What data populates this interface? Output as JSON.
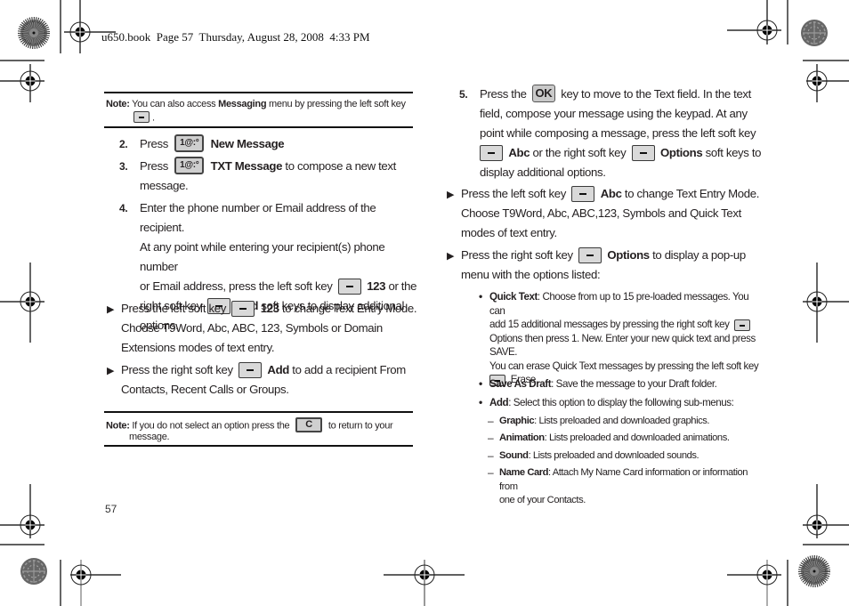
{
  "header": {
    "text": "u650.book  Page 57  Thursday, August 28, 2008  4:33 PM"
  },
  "left_column": {
    "note_top": {
      "label": "Note:",
      "text_before": "You can also access ",
      "bold": "Messaging",
      "text_after": " menu by pressing the left soft key",
      "end": ".",
      "key_icon": "left-soft-key-icon"
    },
    "steps": [
      {
        "number": "2.",
        "prefix": "Press",
        "key_label": "1@:°",
        "bold": "New Message",
        "rest": ""
      },
      {
        "number": "3.",
        "prefix": "Press",
        "key_label": "1@:°",
        "bold": "TXT Message",
        "rest": " to compose a new text",
        "line2": "message."
      },
      {
        "number": "4.",
        "lines": [
          "Enter the phone number or Email address of the recipient.",
          "At any point while entering your recipient(s) phone number"
        ],
        "line3_before": "or Email address, press the left soft key",
        "line3_bold": "123",
        "line3_after": " or the",
        "line4_before": "right soft key",
        "line4_bold": "Add",
        "line4_after": " soft keys to display additional",
        "line5": "options."
      }
    ],
    "bullets": [
      {
        "before": "Press the left soft key",
        "bold": "123",
        "after": " to change Text Entry Mode.",
        "line2": "Choose T9Word, Abc, ABC, 123, Symbols or Domain",
        "line3": "Extensions modes of text entry."
      },
      {
        "before": "Press the right soft key",
        "bold": "Add",
        "after": " to add a recipient From",
        "line2": "Contacts, Recent Calls or Groups."
      }
    ],
    "note_bottom": {
      "label": "Note:",
      "text_before": "If you do not select an option press the",
      "key_label": "C",
      "text_after": "to return to your",
      "line2": "message."
    },
    "page_number": "57"
  },
  "right_column": {
    "step5": {
      "number": "5.",
      "l1_before": "Press the",
      "key_label": "OK",
      "l1_after": "key to move to the Text field. In the text",
      "l2": "field, compose your message using the keypad. At any",
      "l3": "point while composing a message, press the left soft key",
      "l4_bold1": "Abc",
      "l4_mid": " or the right soft key",
      "l4_bold2": "Options",
      "l4_after": " soft keys to",
      "l5": "display additional options."
    },
    "bullets": [
      {
        "before": "Press the left soft key",
        "bold": "Abc",
        "after": " to change Text Entry Mode.",
        "line2": "Choose T9Word, Abc, ABC,123, Symbols and Quick Text",
        "line3": "modes of text entry."
      },
      {
        "before": "Press the right soft key",
        "bold": "Options",
        "after": " to display a pop-up",
        "line2": "menu with the options listed:"
      }
    ],
    "options": [
      {
        "bold": "Quick Text",
        "l1": ": Choose from up to 15 pre-loaded messages. You can",
        "l2": "add 15 additional messages by pressing the right soft key",
        "l3": "Options then press 1. New. Enter your new quick text and press",
        "l4": "SAVE.",
        "l5": "You can erase Quick Text messages by pressing the left soft key",
        "l6": "Erase."
      },
      {
        "bold": "Save As Draft",
        "text": ": Save the message to your Draft folder."
      },
      {
        "bold": "Add",
        "text": ": Select this option to display the following sub-menus:"
      }
    ],
    "sub_menus": [
      {
        "bold": "Graphic",
        "text": ": Lists preloaded and downloaded graphics."
      },
      {
        "bold": "Animation",
        "text": ": Lists preloaded and downloaded animations."
      },
      {
        "bold": "Sound",
        "text": ": Lists preloaded and downloaded sounds."
      },
      {
        "bold": "Name Card",
        "text": ": Attach My Name Card information or information from",
        "line2": "one of your Contacts."
      }
    ]
  },
  "icons": {
    "bullet_arrow": "▶",
    "bullet_dot": "•",
    "dash": "–"
  }
}
